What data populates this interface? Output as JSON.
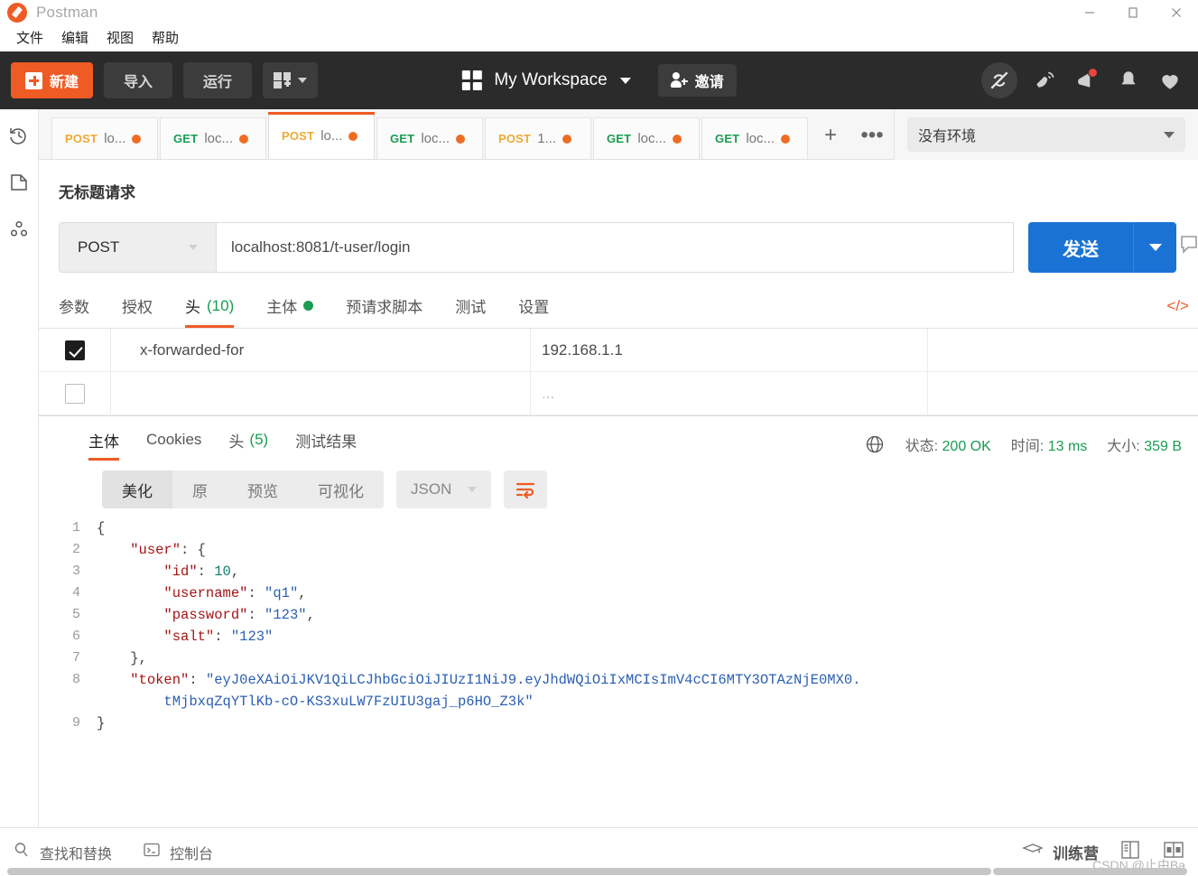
{
  "window": {
    "title": "Postman",
    "controls": {
      "minimize": "minimize-icon",
      "maximize": "maximize-icon",
      "close": "close-icon"
    }
  },
  "menubar": {
    "items": [
      "文件",
      "编辑",
      "视图",
      "帮助"
    ]
  },
  "toolbar": {
    "new_label": "新建",
    "import_label": "导入",
    "runner_label": "运行",
    "workspace_name": "My Workspace",
    "invite_label": "邀请",
    "right_icons": [
      "sync-off-icon",
      "satellite-icon",
      "megaphone-icon",
      "bell-icon",
      "heart-icon"
    ]
  },
  "rail": {
    "icons": [
      "history-icon",
      "collections-icon",
      "apis-icon"
    ]
  },
  "tabs": {
    "items": [
      {
        "verb": "POST",
        "label": "lo...",
        "active": false,
        "unsaved": true
      },
      {
        "verb": "GET",
        "label": "loc...",
        "active": false,
        "unsaved": true
      },
      {
        "verb": "POST",
        "label": "lo...",
        "active": true,
        "unsaved": true
      },
      {
        "verb": "GET",
        "label": "loc...",
        "active": false,
        "unsaved": true
      },
      {
        "verb": "POST",
        "label": "1...",
        "active": false,
        "unsaved": true
      },
      {
        "verb": "GET",
        "label": "loc...",
        "active": false,
        "unsaved": true
      },
      {
        "verb": "GET",
        "label": "loc...",
        "active": false,
        "unsaved": true
      }
    ],
    "add_label": "+",
    "more_label": "•••"
  },
  "environment": {
    "selected": "没有环境"
  },
  "request": {
    "title": "无标题请求",
    "method": "POST",
    "url": "localhost:8081/t-user/login",
    "send_label": "发送",
    "tabs": [
      {
        "label": "参数",
        "count": "",
        "active": false,
        "dot": false
      },
      {
        "label": "授权",
        "count": "",
        "active": false,
        "dot": false
      },
      {
        "label": "头",
        "count": "(10)",
        "active": true,
        "dot": false
      },
      {
        "label": "主体",
        "count": "",
        "active": false,
        "dot": true
      },
      {
        "label": "预请求脚本",
        "count": "",
        "active": false,
        "dot": false
      },
      {
        "label": "测试",
        "count": "",
        "active": false,
        "dot": false
      },
      {
        "label": "设置",
        "count": "",
        "active": false,
        "dot": false
      }
    ],
    "headers": [
      {
        "checked": true,
        "key": "x-forwarded-for",
        "value": "192.168.1.1"
      },
      {
        "checked": false,
        "key": "",
        "value": "..."
      }
    ]
  },
  "response": {
    "tabs": [
      {
        "label": "主体",
        "count": "",
        "active": true
      },
      {
        "label": "Cookies",
        "count": "",
        "active": false
      },
      {
        "label": "头",
        "count": "(5)",
        "active": false
      },
      {
        "label": "测试结果",
        "count": "",
        "active": false
      }
    ],
    "meta": {
      "status_label": "状态:",
      "status_value": "200 OK",
      "time_label": "时间:",
      "time_value": "13 ms",
      "size_label": "大小:",
      "size_value": "359 B"
    },
    "viewbar": {
      "modes": [
        "美化",
        "原",
        "预览",
        "可视化"
      ],
      "active_mode": "美化",
      "format": "JSON",
      "wrap_icon": "word-wrap-icon"
    },
    "body": {
      "language": "json",
      "lines": [
        {
          "no": "1",
          "tokens": [
            {
              "t": "{",
              "c": "p"
            }
          ]
        },
        {
          "no": "2",
          "tokens": [
            {
              "t": "    ",
              "c": "p"
            },
            {
              "t": "\"user\"",
              "c": "k"
            },
            {
              "t": ": {",
              "c": "p"
            }
          ]
        },
        {
          "no": "3",
          "tokens": [
            {
              "t": "        ",
              "c": "p"
            },
            {
              "t": "\"id\"",
              "c": "k"
            },
            {
              "t": ": ",
              "c": "p"
            },
            {
              "t": "10",
              "c": "n"
            },
            {
              "t": ",",
              "c": "p"
            }
          ]
        },
        {
          "no": "4",
          "tokens": [
            {
              "t": "        ",
              "c": "p"
            },
            {
              "t": "\"username\"",
              "c": "k"
            },
            {
              "t": ": ",
              "c": "p"
            },
            {
              "t": "\"q1\"",
              "c": "s"
            },
            {
              "t": ",",
              "c": "p"
            }
          ]
        },
        {
          "no": "5",
          "tokens": [
            {
              "t": "        ",
              "c": "p"
            },
            {
              "t": "\"password\"",
              "c": "k"
            },
            {
              "t": ": ",
              "c": "p"
            },
            {
              "t": "\"123\"",
              "c": "s"
            },
            {
              "t": ",",
              "c": "p"
            }
          ]
        },
        {
          "no": "6",
          "tokens": [
            {
              "t": "        ",
              "c": "p"
            },
            {
              "t": "\"salt\"",
              "c": "k"
            },
            {
              "t": ": ",
              "c": "p"
            },
            {
              "t": "\"123\"",
              "c": "s"
            }
          ]
        },
        {
          "no": "7",
          "tokens": [
            {
              "t": "    },",
              "c": "p"
            }
          ]
        },
        {
          "no": "8",
          "tokens": [
            {
              "t": "    ",
              "c": "p"
            },
            {
              "t": "\"token\"",
              "c": "k"
            },
            {
              "t": ": ",
              "c": "p"
            },
            {
              "t": "\"eyJ0eXAiOiJKV1QiLCJhbGciOiJIUzI1NiJ9.eyJhdWQiOiIxMCIsImV4cCI6MTY3OTAzNjE0MX0.\n        tMjbxqZqYTlKb-cO-KS3xuLW7FzUIU3gaj_p6HO_Z3k\"",
              "c": "s"
            }
          ]
        },
        {
          "no": "9",
          "tokens": [
            {
              "t": "}",
              "c": "p"
            }
          ]
        }
      ]
    }
  },
  "statusbar": {
    "find_replace": "查找和替换",
    "console": "控制台",
    "bootcamp": "训练营",
    "layout_icons": [
      "two-pane-icon",
      "split-pane-icon"
    ],
    "watermark": "CSDN @止由Ba"
  }
}
